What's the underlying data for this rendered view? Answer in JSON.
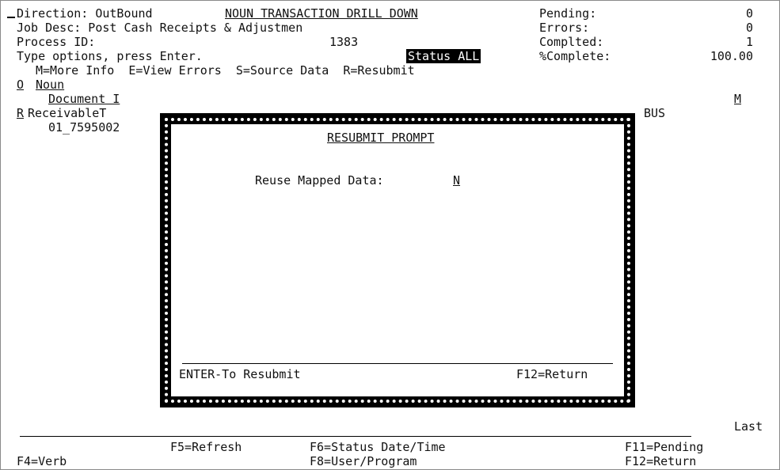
{
  "header": {
    "direction_label": "Direction: OutBound",
    "screen_title": "NOUN TRANSACTION DRILL DOWN",
    "job_desc": "Job Desc: Post Cash Receipts & Adjustmen",
    "process_id_label": "Process ID:",
    "process_id_value": "1383",
    "instructions": "Type options, press Enter.",
    "status_badge": "Status ALL",
    "options_line": "M=More Info  E=View Errors  S=Source Data  R=Resubmit"
  },
  "counters": {
    "pending_label": "Pending:",
    "pending_value": "0",
    "errors_label": "Errors:",
    "errors_value": "0",
    "completed_label": "Complted:",
    "completed_value": "1",
    "percent_label": "%Complete:",
    "percent_value": "100.00"
  },
  "columns": {
    "opt_header": "O",
    "noun_header": "Noun",
    "document_header": "Document I",
    "m_header": "M"
  },
  "row": {
    "option": "R",
    "noun": "ReceivableT",
    "document": "01_7595002",
    "bus": "BUS"
  },
  "popup": {
    "title": "RESUBMIT PROMPT",
    "reuse_label": "Reuse Mapped Data:",
    "reuse_value": "N",
    "enter_key": "ENTER-To Resubmit",
    "f12_key": "F12=Return"
  },
  "footer": {
    "position": "Last",
    "f5": "F5=Refresh",
    "f6": "F6=Status Date/Time",
    "f11": "F11=Pending",
    "f4": "F4=Verb",
    "f8": "F8=User/Program",
    "f12": "F12=Return"
  }
}
